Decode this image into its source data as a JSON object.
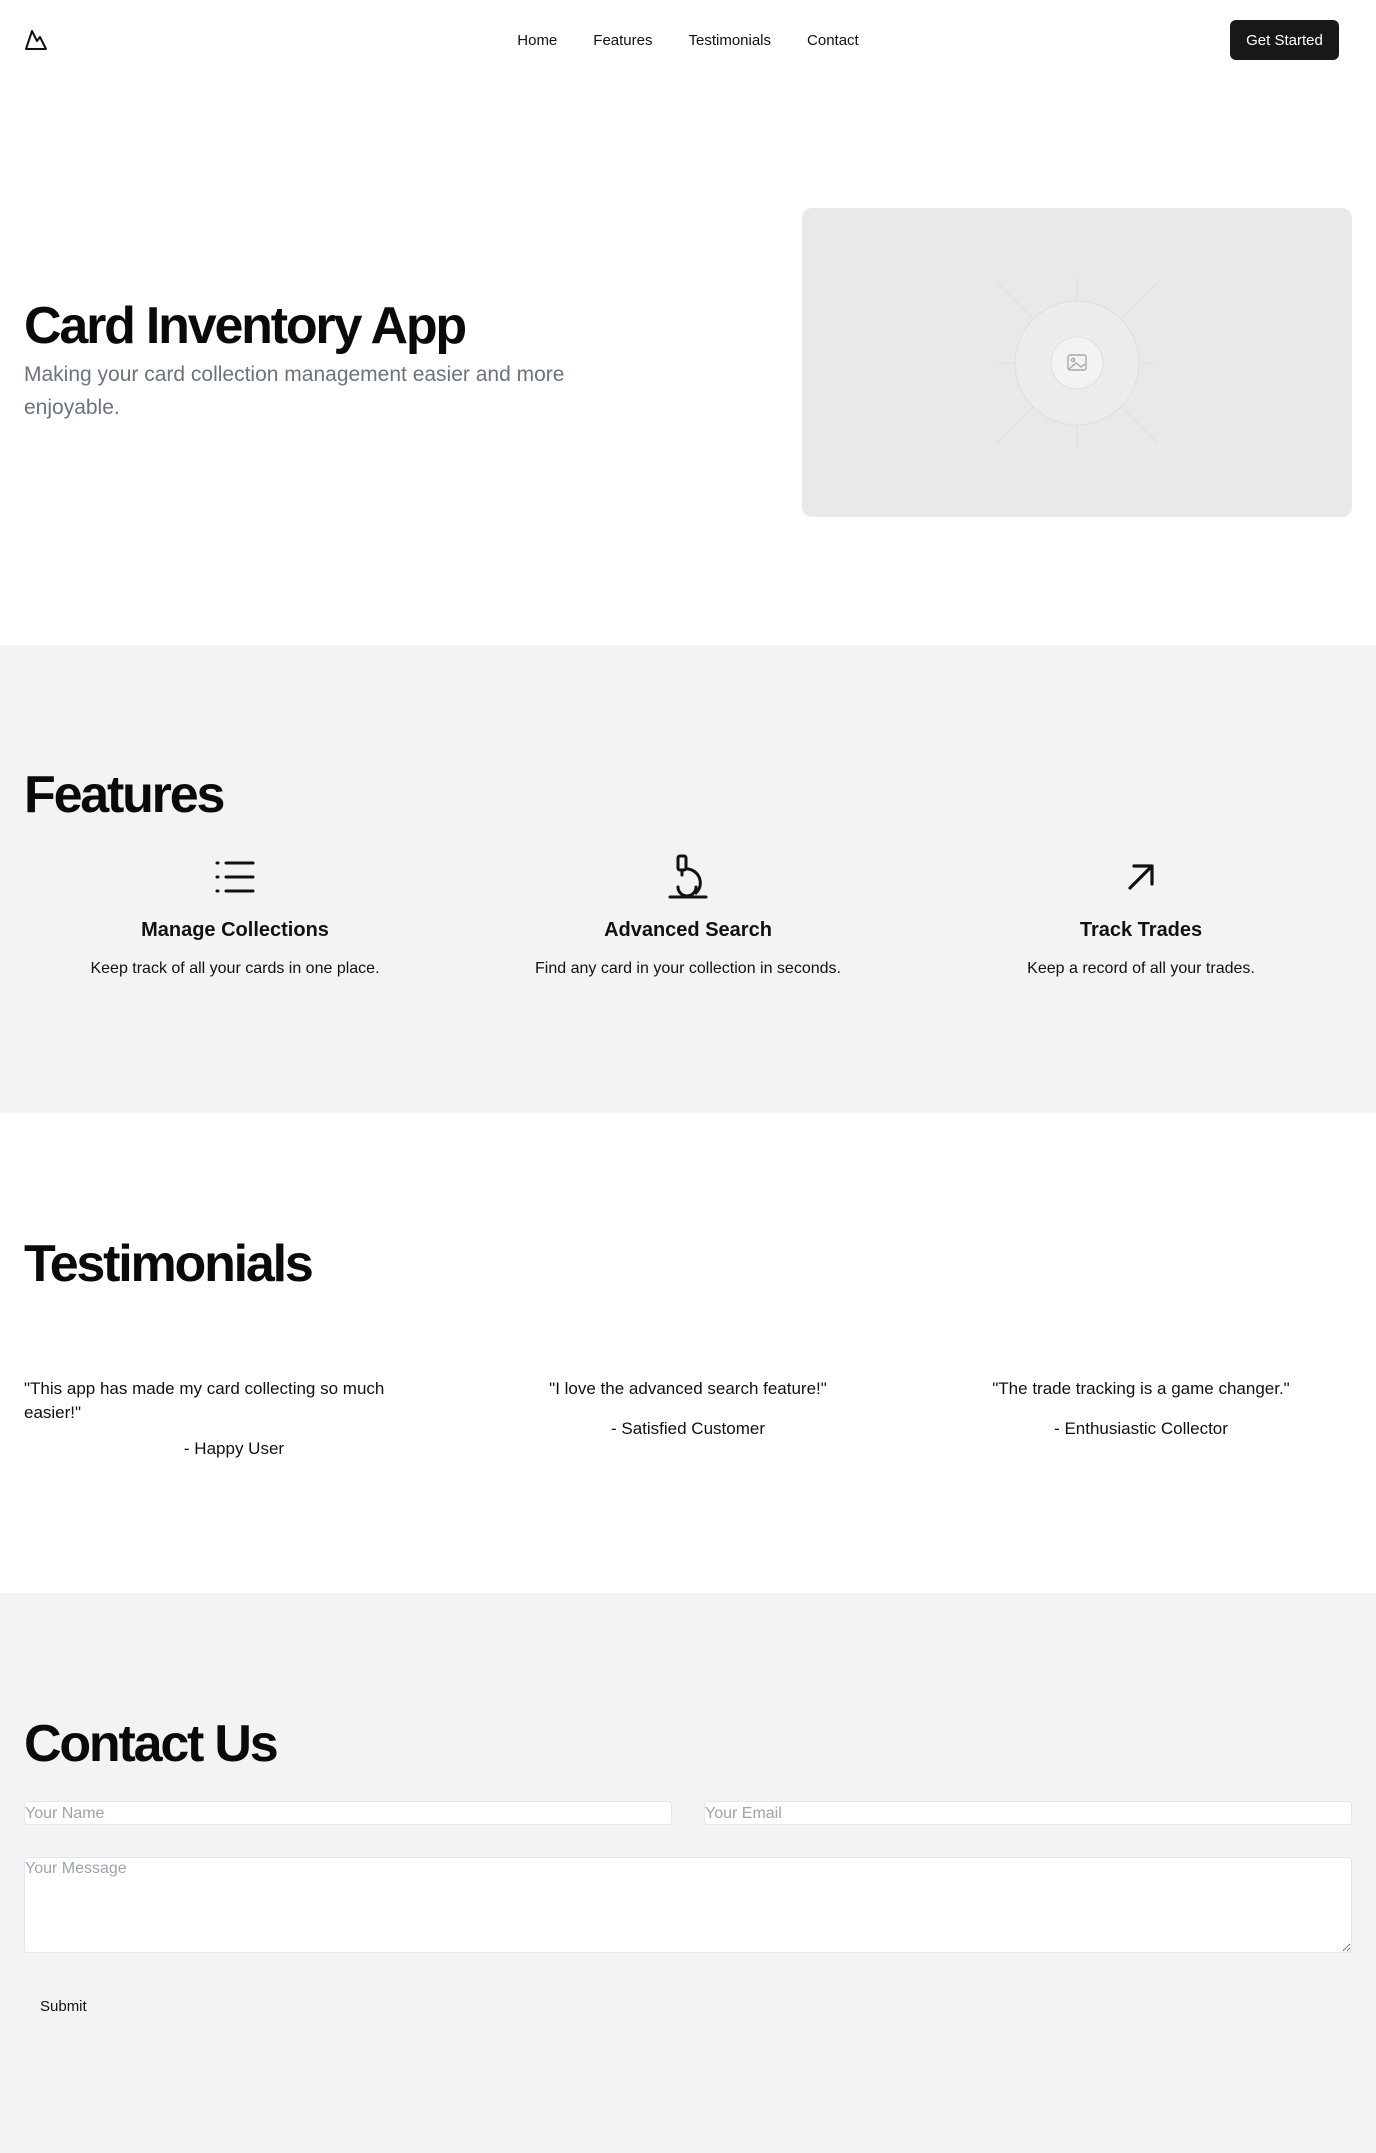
{
  "nav": {
    "logo_icon": "mountain-logo-icon",
    "links": [
      "Home",
      "Features",
      "Testimonials",
      "Contact"
    ],
    "cta_label": "Get Started"
  },
  "hero": {
    "title": "Card Inventory App",
    "subtitle": "Making your card collection management easier and more enjoyable.",
    "image_icon": "image-placeholder-icon"
  },
  "features": {
    "heading": "Features",
    "items": [
      {
        "icon": "list-icon",
        "title": "Manage Collections",
        "description": "Keep track of all your cards in one place."
      },
      {
        "icon": "microscope-icon",
        "title": "Advanced Search",
        "description": "Find any card in your collection in seconds."
      },
      {
        "icon": "arrow-up-right-icon",
        "title": "Track Trades",
        "description": "Keep a record of all your trades."
      }
    ]
  },
  "testimonials": {
    "heading": "Testimonials",
    "items": [
      {
        "quote": "\"This app has made my card collecting so much easier!\"",
        "author": "- Happy User"
      },
      {
        "quote": "\"I love the advanced search feature!\"",
        "author": "- Satisfied Customer"
      },
      {
        "quote": "\"The trade tracking is a game changer.\"",
        "author": "- Enthusiastic Collector"
      }
    ]
  },
  "contact": {
    "heading": "Contact Us",
    "name_placeholder": "Your Name",
    "email_placeholder": "Your Email",
    "message_placeholder": "Your Message",
    "submit_label": "Submit"
  },
  "colors": {
    "cta_bg": "#18181b",
    "section_bg": "#f2f3f5",
    "subtitle": "#6b7280",
    "placeholder_bg": "#e9e9e9"
  }
}
